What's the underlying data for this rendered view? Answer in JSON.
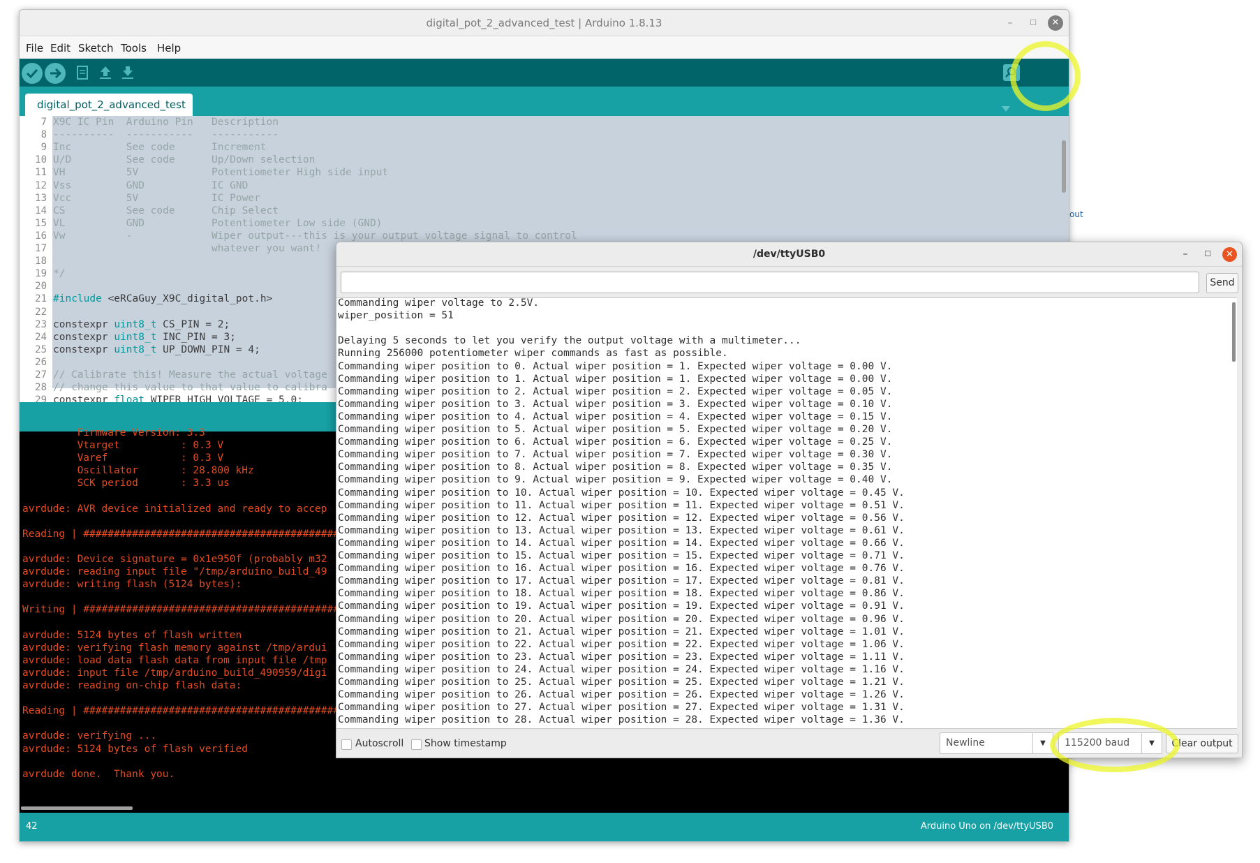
{
  "ide": {
    "title": "digital_pot_2_advanced_test | Arduino 1.8.13",
    "window_buttons": {
      "minimize": "–",
      "maximize": "☐",
      "close": "✕"
    },
    "menus": [
      {
        "label": "File"
      },
      {
        "label": "Edit"
      },
      {
        "label": "Sketch"
      },
      {
        "label": "Tools"
      },
      {
        "label": "Help"
      }
    ],
    "toolbar": {
      "verify_icon": "check-icon",
      "upload_icon": "arrow-right-icon",
      "new_icon": "new-file-icon",
      "open_icon": "arrow-up-icon",
      "save_icon": "arrow-down-icon",
      "serial_monitor_icon": "magnifier-icon"
    },
    "tab": "digital_pot_2_advanced_test",
    "code_lines": [
      {
        "n": "7",
        "text": "X9C IC Pin  Arduino Pin   Description"
      },
      {
        "n": "8",
        "text": "----------  -----------   -----------"
      },
      {
        "n": "9",
        "text": "Inc         See code      Increment"
      },
      {
        "n": "10",
        "text": "U/D         See code      Up/Down selection"
      },
      {
        "n": "11",
        "text": "VH          5V            Potentiometer High side input"
      },
      {
        "n": "12",
        "text": "Vss         GND           IC GND"
      },
      {
        "n": "13",
        "text": "Vcc         5V            IC Power"
      },
      {
        "n": "14",
        "text": "CS          See code      Chip Select"
      },
      {
        "n": "15",
        "text": "VL          GND           Potentiometer Low side (GND)"
      },
      {
        "n": "16",
        "text": "Vw          -             Wiper output---this is your output voltage signal to control"
      },
      {
        "n": "17",
        "text": "                          whatever you want!"
      },
      {
        "n": "18",
        "text": ""
      },
      {
        "n": "19",
        "text": "*/"
      },
      {
        "n": "20",
        "text": ""
      },
      {
        "n": "21",
        "text": "#include <eRCaGuy_X9C_digital_pot.h>"
      },
      {
        "n": "22",
        "text": ""
      },
      {
        "n": "23",
        "text": "constexpr uint8_t CS_PIN = 2;"
      },
      {
        "n": "24",
        "text": "constexpr uint8_t INC_PIN = 3;"
      },
      {
        "n": "25",
        "text": "constexpr uint8_t UP_DOWN_PIN = 4;"
      },
      {
        "n": "26",
        "text": ""
      },
      {
        "n": "27",
        "text": "// Calibrate this! Measure the actual voltage"
      },
      {
        "n": "28",
        "text": "// change this value to that value to calibra"
      },
      {
        "n": "29",
        "text": "constexpr float WIPER_HIGH_VOLTAGE = 5.0;"
      }
    ],
    "console_lines": [
      "         Firmware Version: 3.3",
      "         Vtarget          : 0.3 V",
      "         Varef            : 0.3 V",
      "         Oscillator       : 28.800 kHz",
      "         SCK period       : 3.3 us",
      "",
      "avrdude: AVR device initialized and ready to accep",
      "",
      "Reading | ################################################",
      "",
      "avrdude: Device signature = 0x1e950f (probably m32",
      "avrdude: reading input file \"/tmp/arduino_build_49",
      "avrdude: writing flash (5124 bytes):",
      "",
      "Writing | ################################################",
      "",
      "avrdude: 5124 bytes of flash written",
      "avrdude: verifying flash memory against /tmp/ardui",
      "avrdude: load data flash data from input file /tmp",
      "avrdude: input file /tmp/arduino_build_490959/digi",
      "avrdude: reading on-chip flash data:",
      "",
      "Reading | ################################################",
      "",
      "avrdude: verifying ...",
      "avrdude: 5124 bytes of flash verified",
      "",
      "avrdude done.  Thank you."
    ],
    "status": {
      "line": "42",
      "board": "Arduino Uno on /dev/ttyUSB0"
    },
    "side_fragment": "out"
  },
  "serial_monitor": {
    "title": "/dev/ttyUSB0",
    "window_buttons": {
      "minimize": "–",
      "maximize": "☐",
      "close": "✕"
    },
    "input_value": "",
    "send_label": "Send",
    "output_lines": [
      "Commanding wiper voltage to 2.5V.",
      "wiper_position = 51",
      "",
      "Delaying 5 seconds to let you verify the output voltage with a multimeter...",
      "Running 256000 potentiometer wiper commands as fast as possible.",
      "Commanding wiper position to 0. Actual wiper position = 1. Expected wiper voltage = 0.00 V.",
      "Commanding wiper position to 1. Actual wiper position = 1. Expected wiper voltage = 0.00 V.",
      "Commanding wiper position to 2. Actual wiper position = 2. Expected wiper voltage = 0.05 V.",
      "Commanding wiper position to 3. Actual wiper position = 3. Expected wiper voltage = 0.10 V.",
      "Commanding wiper position to 4. Actual wiper position = 4. Expected wiper voltage = 0.15 V.",
      "Commanding wiper position to 5. Actual wiper position = 5. Expected wiper voltage = 0.20 V.",
      "Commanding wiper position to 6. Actual wiper position = 6. Expected wiper voltage = 0.25 V.",
      "Commanding wiper position to 7. Actual wiper position = 7. Expected wiper voltage = 0.30 V.",
      "Commanding wiper position to 8. Actual wiper position = 8. Expected wiper voltage = 0.35 V.",
      "Commanding wiper position to 9. Actual wiper position = 9. Expected wiper voltage = 0.40 V.",
      "Commanding wiper position to 10. Actual wiper position = 10. Expected wiper voltage = 0.45 V.",
      "Commanding wiper position to 11. Actual wiper position = 11. Expected wiper voltage = 0.51 V.",
      "Commanding wiper position to 12. Actual wiper position = 12. Expected wiper voltage = 0.56 V.",
      "Commanding wiper position to 13. Actual wiper position = 13. Expected wiper voltage = 0.61 V.",
      "Commanding wiper position to 14. Actual wiper position = 14. Expected wiper voltage = 0.66 V.",
      "Commanding wiper position to 15. Actual wiper position = 15. Expected wiper voltage = 0.71 V.",
      "Commanding wiper position to 16. Actual wiper position = 16. Expected wiper voltage = 0.76 V.",
      "Commanding wiper position to 17. Actual wiper position = 17. Expected wiper voltage = 0.81 V.",
      "Commanding wiper position to 18. Actual wiper position = 18. Expected wiper voltage = 0.86 V.",
      "Commanding wiper position to 19. Actual wiper position = 19. Expected wiper voltage = 0.91 V.",
      "Commanding wiper position to 20. Actual wiper position = 20. Expected wiper voltage = 0.96 V.",
      "Commanding wiper position to 21. Actual wiper position = 21. Expected wiper voltage = 1.01 V.",
      "Commanding wiper position to 22. Actual wiper position = 22. Expected wiper voltage = 1.06 V.",
      "Commanding wiper position to 23. Actual wiper position = 23. Expected wiper voltage = 1.11 V.",
      "Commanding wiper position to 24. Actual wiper position = 24. Expected wiper voltage = 1.16 V.",
      "Commanding wiper position to 25. Actual wiper position = 25. Expected wiper voltage = 1.21 V.",
      "Commanding wiper position to 26. Actual wiper position = 26. Expected wiper voltage = 1.26 V.",
      "Commanding wiper position to 27. Actual wiper position = 27. Expected wiper voltage = 1.31 V.",
      "Commanding wiper position to 28. Actual wiper position = 28. Expected wiper voltage = 1.36 V."
    ],
    "autoscroll_label": "Autoscroll",
    "autoscroll_checked": false,
    "timestamp_label": "Show timestamp",
    "timestamp_checked": false,
    "line_ending": "Newline",
    "baud": "115200 baud",
    "clear_label": "Clear output"
  },
  "colors": {
    "toolbar": "#006468",
    "band": "#17a1a5",
    "button": "#4db7bb",
    "console_text": "#e34c22",
    "highlight": "#ebf528",
    "close_button": "#e95420"
  }
}
